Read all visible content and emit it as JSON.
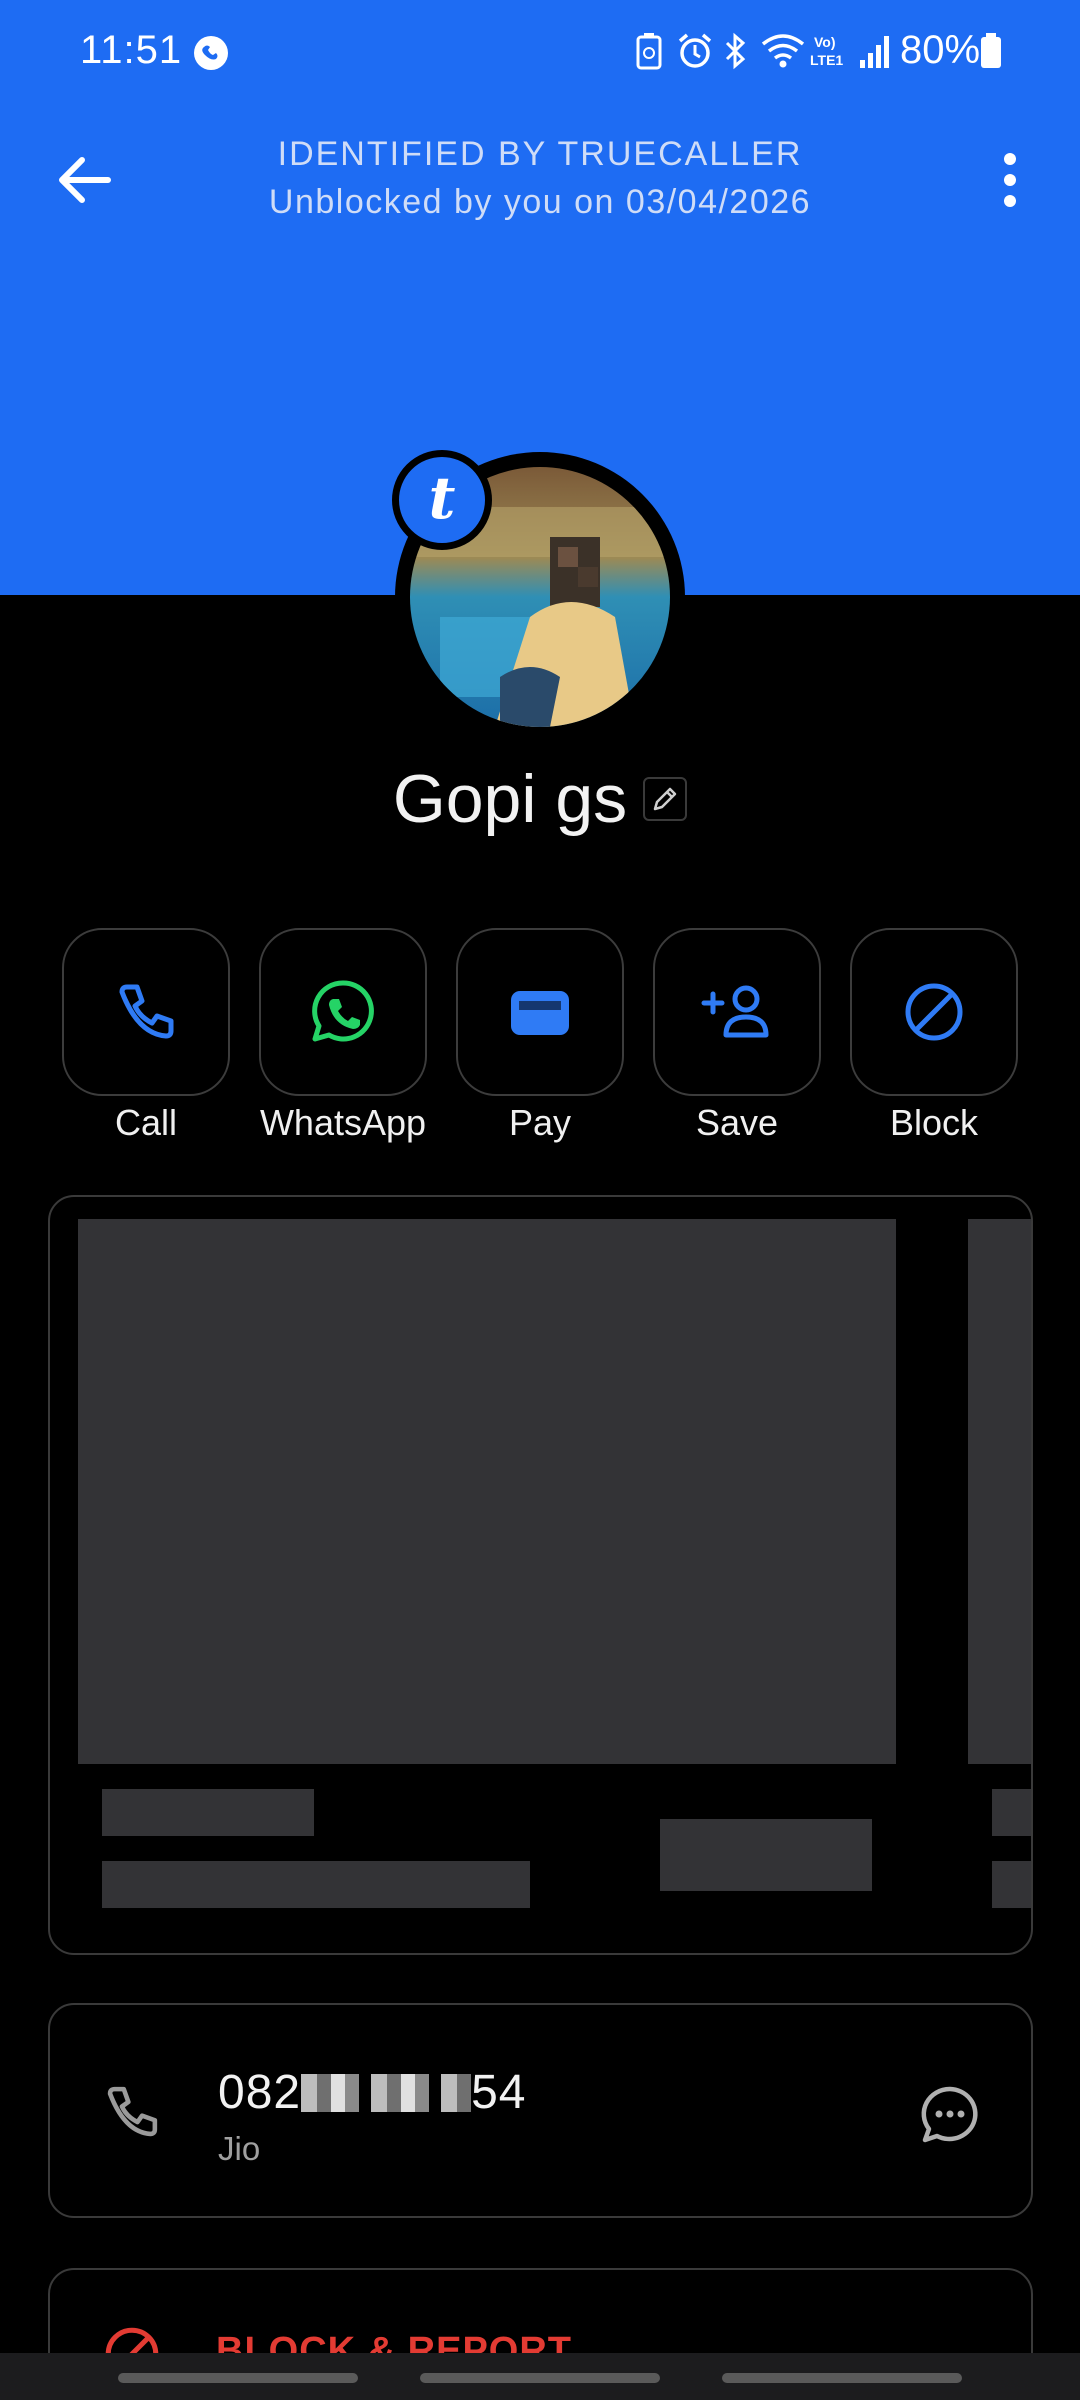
{
  "status_bar": {
    "time": "11:51",
    "battery": "80%"
  },
  "header": {
    "title": "IDENTIFIED BY TRUECALLER",
    "subtitle": "Unblocked by you on 03/04/2026",
    "badge_letter": "t"
  },
  "profile": {
    "name": "Gopi gs"
  },
  "actions": [
    {
      "label": "Call",
      "icon": "phone-icon"
    },
    {
      "label": "WhatsApp",
      "icon": "whatsapp-icon"
    },
    {
      "label": "Pay",
      "icon": "wallet-icon"
    },
    {
      "label": "Save",
      "icon": "add-person-icon"
    },
    {
      "label": "Block",
      "icon": "block-icon"
    }
  ],
  "phone": {
    "number_prefix": "082",
    "number_suffix": "54",
    "carrier": "Jio"
  },
  "block_report": {
    "label": "BLOCK & REPORT"
  },
  "colors": {
    "header_blue": "#1e6cf3",
    "accent_blue": "#2f7bf5",
    "whatsapp_green": "#25d366",
    "danger_red": "#e33b33"
  }
}
